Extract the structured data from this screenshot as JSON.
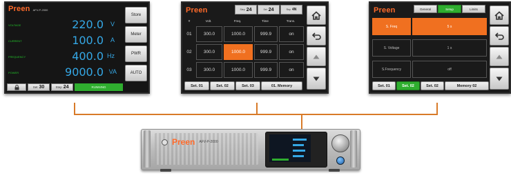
{
  "panel1": {
    "logo": "Preen",
    "model": "AFV-P-2000",
    "rows": [
      {
        "label": "VOLTAGE",
        "value": "220.0",
        "unit": "V"
      },
      {
        "label": "CURRENT",
        "value": "100.0",
        "unit": "A"
      },
      {
        "label": "FREQUENCY",
        "value": "400.0",
        "unit": "Hz"
      },
      {
        "label": "POWER",
        "value": "9000.0",
        "unit": "VA"
      }
    ],
    "side_buttons": [
      "Store",
      "Meter",
      "PWR",
      "AUTO"
    ],
    "footer": {
      "set_label": "Set",
      "set_value": "30",
      "step_label": "Step",
      "step_value": "24",
      "status": "RUNNING"
    }
  },
  "panel2": {
    "logo": "Preen",
    "top_boxes": [
      {
        "label": "Step",
        "value": "24"
      },
      {
        "label": "Set",
        "value": "24"
      },
      {
        "label": "Rep",
        "value": "4N"
      }
    ],
    "headers": [
      "#",
      "Volt.",
      "Freq.",
      "Time",
      "Trans."
    ],
    "rows": [
      {
        "num": "01",
        "volt": "300.0",
        "freq": "1000.0",
        "time": "999.9",
        "trans": "on"
      },
      {
        "num": "02",
        "volt": "300.0",
        "freq": "1000.0",
        "time": "999.9",
        "trans": "on"
      },
      {
        "num": "03",
        "volt": "300.0",
        "freq": "1000.0",
        "time": "999.9",
        "trans": "on"
      }
    ],
    "bottom_buttons": [
      "Set. 01",
      "Set. 02",
      "Set. 03",
      "01. Memory"
    ]
  },
  "panel3": {
    "logo": "Preen",
    "tabs": [
      "General",
      "Setup",
      "Limits"
    ],
    "rows": [
      {
        "label": "S. Freq",
        "value": "5 s"
      },
      {
        "label": "S. Voltage",
        "value": "1 s"
      },
      {
        "label": "S.Frequency",
        "value": "off"
      }
    ],
    "bottom_buttons": [
      "Set. 01",
      "Set. 02",
      "Set. 02",
      "Memory 02"
    ]
  },
  "device": {
    "brand": "Preen",
    "model": "AFV-P-2000"
  },
  "colors": {
    "accent": "#d87a28",
    "highlight": "#f07020",
    "green": "#22c32a",
    "cyan": "#35a8e6"
  }
}
